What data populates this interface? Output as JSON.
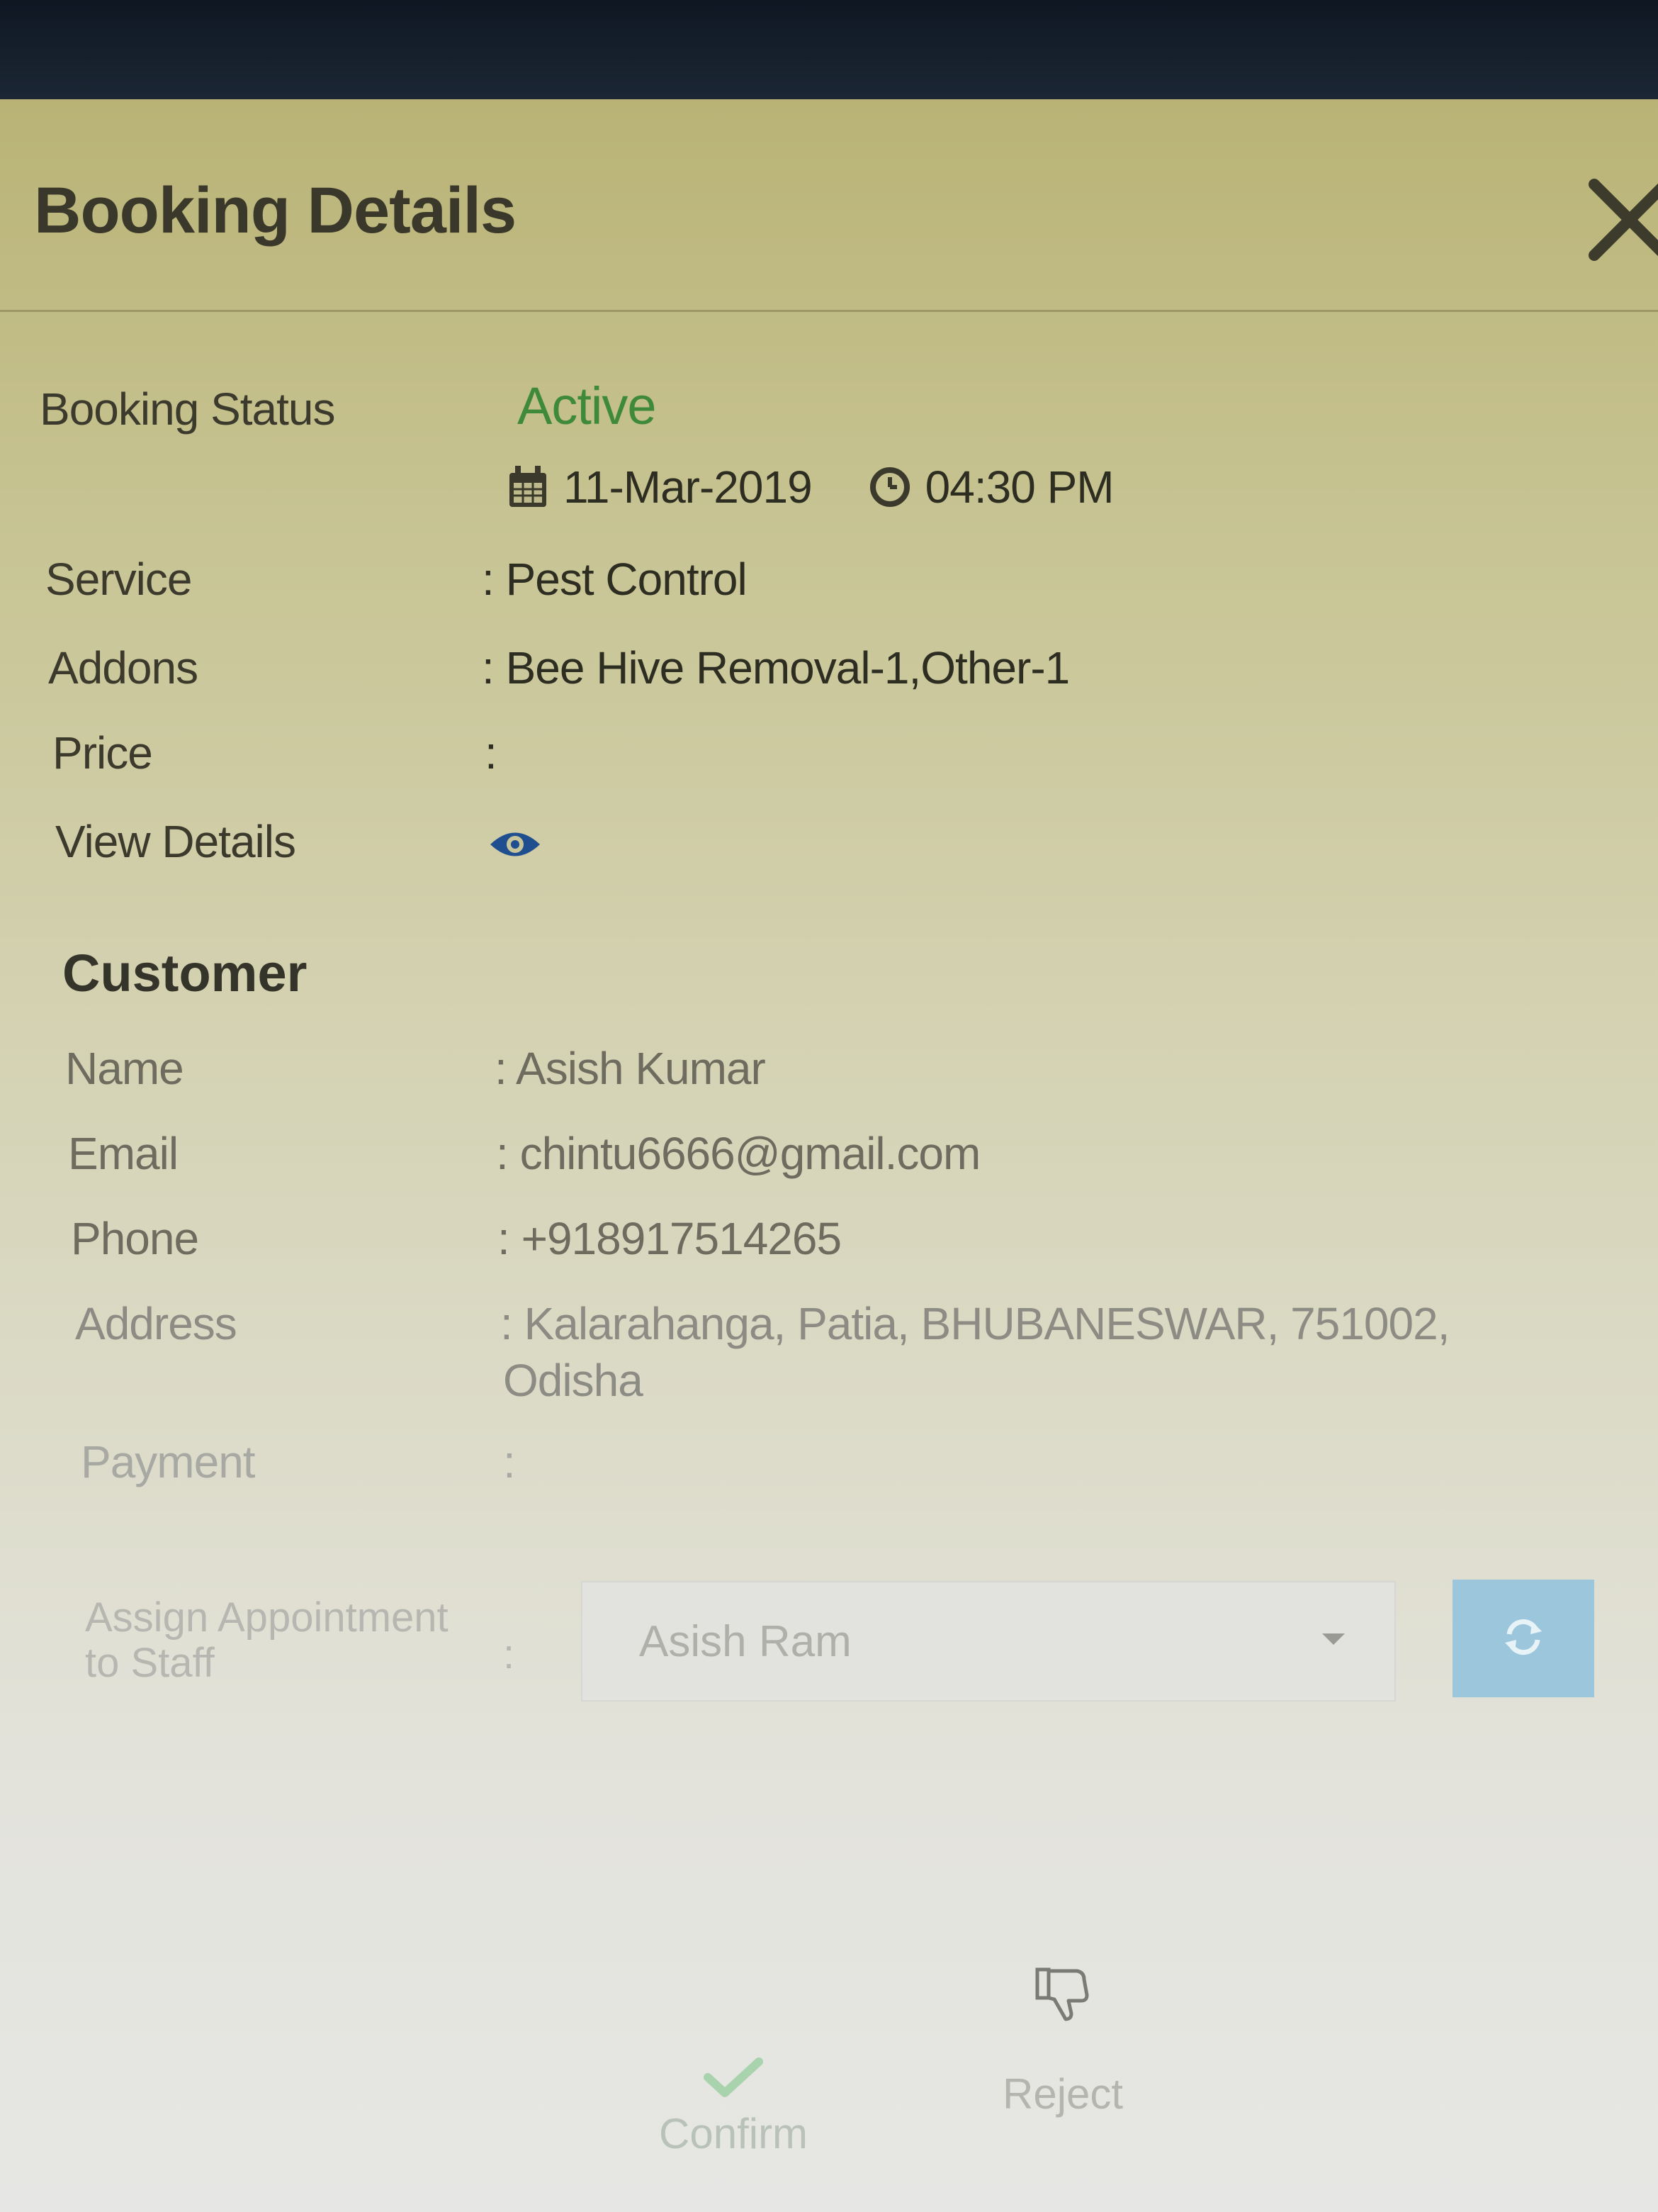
{
  "modal": {
    "title": "Booking Details"
  },
  "booking": {
    "status_label": "Booking Status",
    "status_value": "Active",
    "date": "11-Mar-2019",
    "time": "04:30 PM",
    "service_label": "Service",
    "service_value": ": Pest Control",
    "addons_label": "Addons",
    "addons_value": ": Bee Hive Removal-1,Other-1",
    "price_label": "Price",
    "price_value": ":",
    "view_details_label": "View Details"
  },
  "customer": {
    "heading": "Customer",
    "name_label": "Name",
    "name_value": ": Asish Kumar",
    "email_label": "Email",
    "email_value": ": chintu6666@gmail.com",
    "phone_label": "Phone",
    "phone_value": ": +918917514265",
    "address_label": "Address",
    "address_line1": ": Kalarahanga, Patia, BHUBANESWAR, 751002,",
    "address_line2": "Odisha",
    "payment_label": "Payment",
    "payment_value": ":"
  },
  "assign": {
    "label": "Assign Appointment to Staff",
    "colon": ":",
    "selected_staff": "Asish Ram"
  },
  "actions": {
    "confirm_label": "Confirm",
    "reject_label": "Reject"
  },
  "colors": {
    "status_active": "#3f8a3a",
    "eye_icon": "#1f4f8f",
    "refresh_button": "#9cc6dc"
  },
  "icons": {
    "close": "close-icon",
    "calendar": "calendar-icon",
    "clock": "clock-icon",
    "view": "eye-icon",
    "refresh": "refresh-icon",
    "confirm": "check-icon",
    "reject": "thumbs-down-icon",
    "dropdown": "caret-down-icon"
  }
}
